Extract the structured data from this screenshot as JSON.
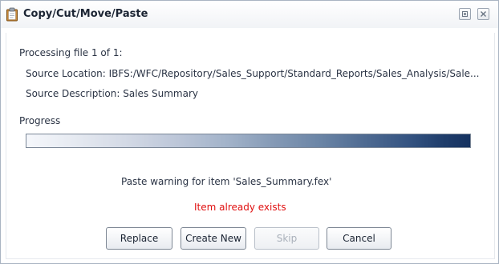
{
  "dialog": {
    "title": "Copy/Cut/Move/Paste",
    "title_icon": "clipboard-icon",
    "restore_icon": "restore-icon",
    "close_icon": "close-icon"
  },
  "status": {
    "processing": "Processing file 1 of 1:",
    "source_location": "Source Location: IBFS:/WFC/Repository/Sales_Support/Standard_Reports/Sales_Analysis/Sale...",
    "source_description": "Source Description: Sales Summary"
  },
  "progress": {
    "label": "Progress",
    "fraction": 1.0
  },
  "messages": {
    "warning": "Paste warning for item 'Sales_Summary.fex'",
    "error": "Item already exists",
    "error_color": "#e01010"
  },
  "buttons": {
    "replace": "Replace",
    "create_new": "Create New",
    "skip": "Skip",
    "cancel": "Cancel"
  }
}
